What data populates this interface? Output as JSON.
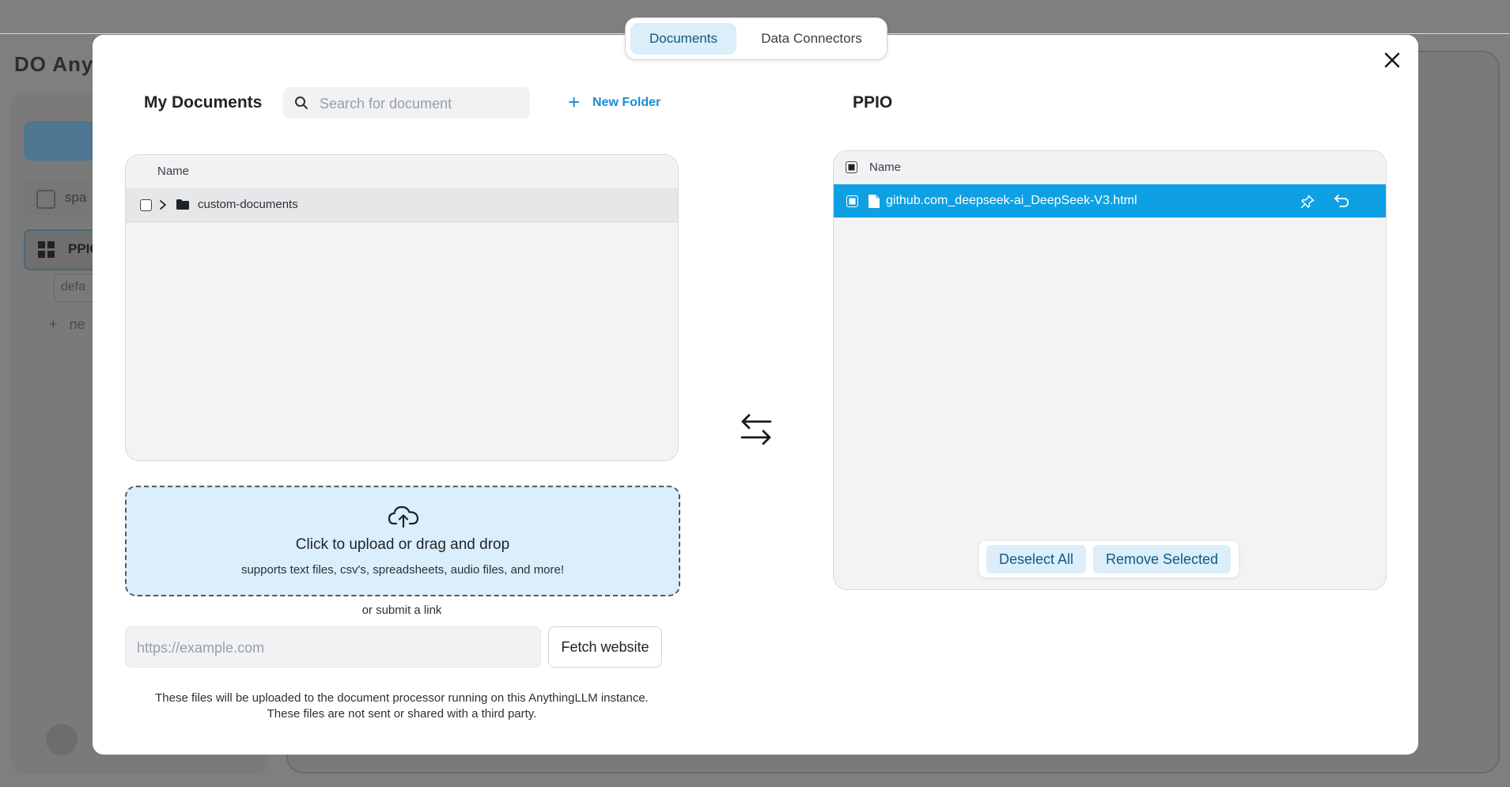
{
  "background": {
    "logo_text": "DO Anyth",
    "workspace_label": "spa",
    "active_workspace_label": "PPIO",
    "thread_label": "defa",
    "new_thread_label": "ne"
  },
  "modal": {
    "tabs": [
      {
        "label": "Documents",
        "active": true
      },
      {
        "label": "Data Connectors",
        "active": false
      }
    ],
    "close_icon": "close-icon"
  },
  "my_documents": {
    "title": "My Documents",
    "search": {
      "placeholder": "Search for document",
      "value": ""
    },
    "new_folder_label": "New Folder",
    "column_name": "Name",
    "rows": [
      {
        "name": "custom-documents",
        "type": "folder",
        "checked": false,
        "expanded": false
      }
    ]
  },
  "upload": {
    "title": "Click to upload or drag and drop",
    "subtitle": "supports text files, csv's, spreadsheets, audio files, and more!",
    "or_link": "or submit a link",
    "url_placeholder": "https://example.com",
    "url_value": "",
    "fetch_label": "Fetch website",
    "note_line1": "These files will be uploaded to the document processor running on this AnythingLLM instance.",
    "note_line2": "These files are not sent or shared with a third party."
  },
  "workspace": {
    "title": "PPIO",
    "column_name": "Name",
    "rows": [
      {
        "name": "github.com_deepseek-ai_DeepSeek-V3.html",
        "selected": true
      }
    ],
    "deselect_all_label": "Deselect All",
    "remove_selected_label": "Remove Selected"
  },
  "colors": {
    "accent": "#0ea0e3",
    "accent_text": "#1d8bd2",
    "tab_active_bg": "#dbeef9",
    "dropzone_bg": "#dbeefb"
  }
}
